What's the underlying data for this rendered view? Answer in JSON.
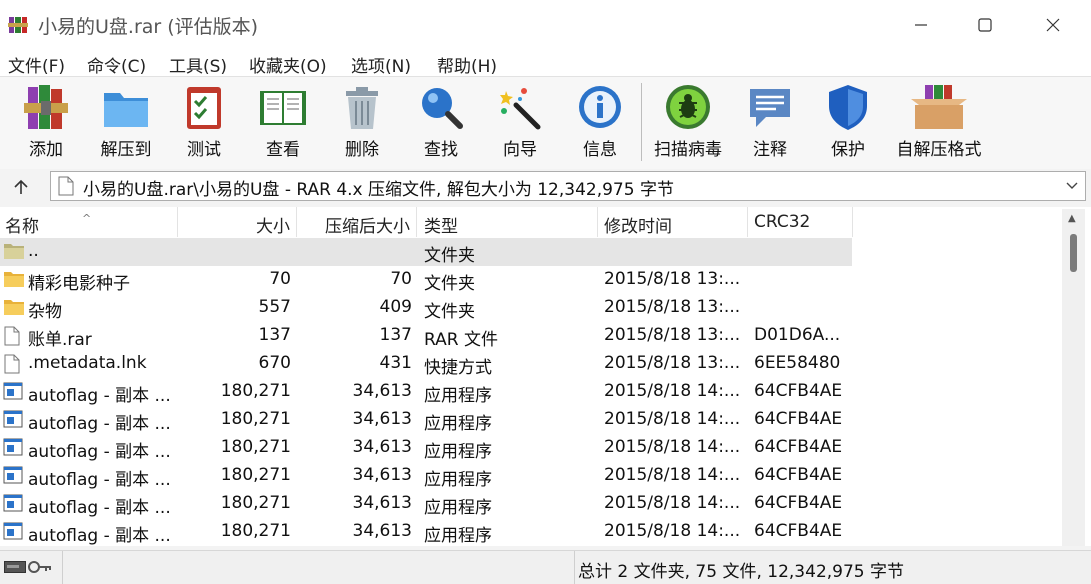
{
  "window": {
    "title": "小易的U盘.rar (评估版本)",
    "controls": [
      "minimize-icon",
      "maximize-icon",
      "close-icon"
    ]
  },
  "menu": [
    "文件(F)",
    "命令(C)",
    "工具(S)",
    "收藏夹(O)",
    "选项(N)",
    "帮助(H)"
  ],
  "toolbar": [
    {
      "label": "添加",
      "icon": "books-add-icon"
    },
    {
      "label": "解压到",
      "icon": "folder-extract-icon"
    },
    {
      "label": "测试",
      "icon": "clipboard-check-icon"
    },
    {
      "label": "查看",
      "icon": "open-book-icon"
    },
    {
      "label": "删除",
      "icon": "trash-can-icon"
    },
    {
      "label": "查找",
      "icon": "magnifier-icon"
    },
    {
      "label": "向导",
      "icon": "magic-wand-icon"
    },
    {
      "label": "信息",
      "icon": "info-icon"
    },
    {
      "label": "扫描病毒",
      "icon": "bug-scan-icon"
    },
    {
      "label": "注释",
      "icon": "comment-icon"
    },
    {
      "label": "保护",
      "icon": "shield-icon"
    },
    {
      "label": "自解压格式",
      "icon": "sfx-box-icon"
    }
  ],
  "address": {
    "path": "小易的U盘.rar\\小易的U盘 - RAR 4.x 压缩文件, 解包大小为 12,342,975 字节"
  },
  "columns": [
    "名称",
    "大小",
    "压缩后大小",
    "类型",
    "修改时间",
    "CRC32"
  ],
  "rows": [
    {
      "name": "..",
      "size": "",
      "packed": "",
      "type": "文件夹",
      "modified": "",
      "crc": "",
      "icon": "folder-up-icon"
    },
    {
      "name": "精彩电影种子",
      "size": "70",
      "packed": "70",
      "type": "文件夹",
      "modified": "2015/8/18 13:...",
      "crc": "",
      "icon": "folder-icon"
    },
    {
      "name": "杂物",
      "size": "557",
      "packed": "409",
      "type": "文件夹",
      "modified": "2015/8/18 13:...",
      "crc": "",
      "icon": "folder-icon"
    },
    {
      "name": "账单.rar",
      "size": "137",
      "packed": "137",
      "type": "RAR 文件",
      "modified": "2015/8/18 13:...",
      "crc": "D01D6A...",
      "icon": "file-icon"
    },
    {
      "name": ".metadata.lnk",
      "size": "670",
      "packed": "431",
      "type": "快捷方式",
      "modified": "2015/8/18 13:...",
      "crc": "6EE58480",
      "icon": "file-icon"
    },
    {
      "name": "autoflag - 副本 ...",
      "size": "180,271",
      "packed": "34,613",
      "type": "应用程序",
      "modified": "2015/8/18 14:...",
      "crc": "64CFB4AE",
      "icon": "exe-icon"
    },
    {
      "name": "autoflag - 副本 ...",
      "size": "180,271",
      "packed": "34,613",
      "type": "应用程序",
      "modified": "2015/8/18 14:...",
      "crc": "64CFB4AE",
      "icon": "exe-icon"
    },
    {
      "name": "autoflag - 副本 ...",
      "size": "180,271",
      "packed": "34,613",
      "type": "应用程序",
      "modified": "2015/8/18 14:...",
      "crc": "64CFB4AE",
      "icon": "exe-icon"
    },
    {
      "name": "autoflag - 副本 ...",
      "size": "180,271",
      "packed": "34,613",
      "type": "应用程序",
      "modified": "2015/8/18 14:...",
      "crc": "64CFB4AE",
      "icon": "exe-icon"
    },
    {
      "name": "autoflag - 副本 ...",
      "size": "180,271",
      "packed": "34,613",
      "type": "应用程序",
      "modified": "2015/8/18 14:...",
      "crc": "64CFB4AE",
      "icon": "exe-icon"
    },
    {
      "name": "autoflag - 副本 ...",
      "size": "180,271",
      "packed": "34,613",
      "type": "应用程序",
      "modified": "2015/8/18 14:...",
      "crc": "64CFB4AE",
      "icon": "exe-icon"
    }
  ],
  "status": {
    "summary": "总计 2 文件夹, 75 文件, 12,342,975 字节",
    "left_icons": [
      "drive-icon",
      "key-icon"
    ]
  }
}
